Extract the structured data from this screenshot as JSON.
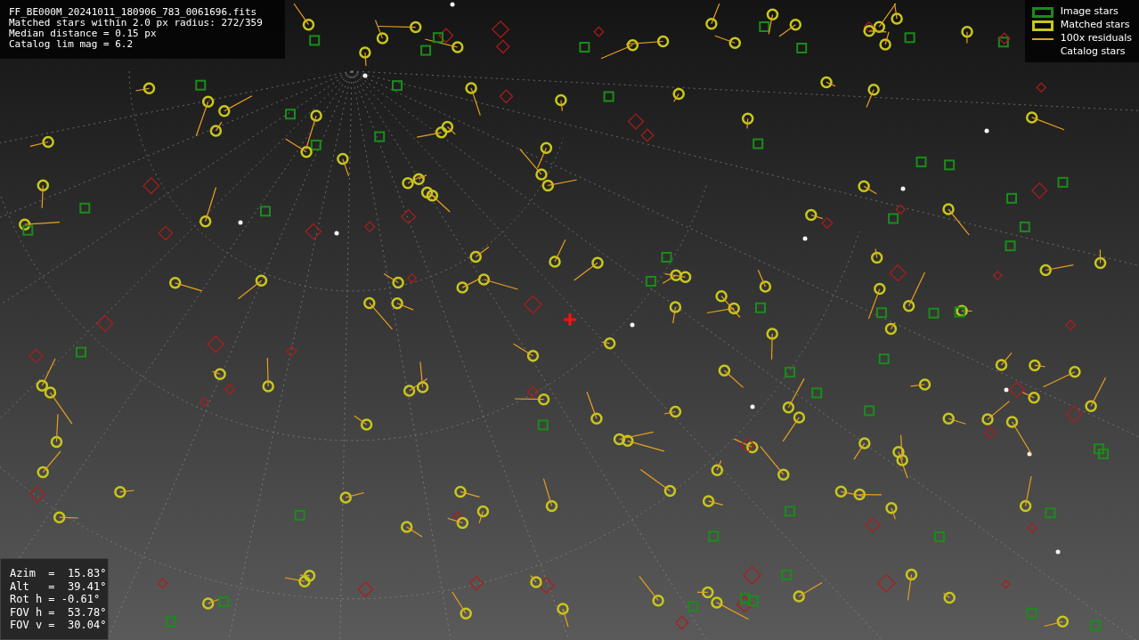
{
  "info": [
    "FF_BE000M_20241011_180906_783_0061696.fits",
    "Matched stars within 2.0 px radius: 272/359",
    "Median distance = 0.15 px",
    "Catalog lim mag = 6.2"
  ],
  "legend": [
    {
      "label": "Image stars",
      "kind": "rect",
      "color": "#1a8c1a"
    },
    {
      "label": "Matched stars",
      "kind": "rect",
      "color": "#c8c81a"
    },
    {
      "label": "100x residuals",
      "kind": "line",
      "color": "#e8a020"
    },
    {
      "label": "Catalog stars",
      "kind": "blank"
    }
  ],
  "pointing": [
    "Azim  =  15.83°",
    "Alt   =  39.41°",
    "Rot h = -0.61°",
    "FOV h =  53.78°",
    "FOV v =  30.04°"
  ]
}
